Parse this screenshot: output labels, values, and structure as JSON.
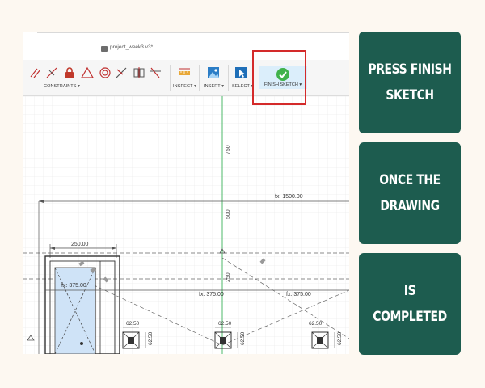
{
  "app": {
    "document_title": "project_week3 v3*"
  },
  "toolbar": {
    "groups": [
      {
        "label": "CONSTRAINTS ▾"
      },
      {
        "label": "INSPECT ▾"
      },
      {
        "label": "INSERT ▾"
      },
      {
        "label": "SELECT ▾"
      },
      {
        "label": "FINISH SKETCH ▾"
      }
    ],
    "finish_icon_color": "#40b24b",
    "highlight_color": "#d42a2a"
  },
  "canvas": {
    "dimensions": {
      "v750": "750",
      "v500": "500",
      "v250": "250",
      "fx1500": "fx: 1500.00",
      "d250": "250.00",
      "fx375a": "fx: 375.00",
      "fx375b": "fx: 375.00",
      "fx375c": "fx: 375.00",
      "d62a": "62.50",
      "d62b": "62.50",
      "d62c": "62.50",
      "d62d": "62.50",
      "d62e": "62.50",
      "d62f": "62.50"
    }
  },
  "panels": [
    {
      "text": "PRESS FINISH SKETCH"
    },
    {
      "text": "ONCE THE DRAWING"
    },
    {
      "text": "IS COMPLETED"
    }
  ],
  "colors": {
    "background": "#fdf8f1",
    "panel": "#1d5c4f"
  }
}
